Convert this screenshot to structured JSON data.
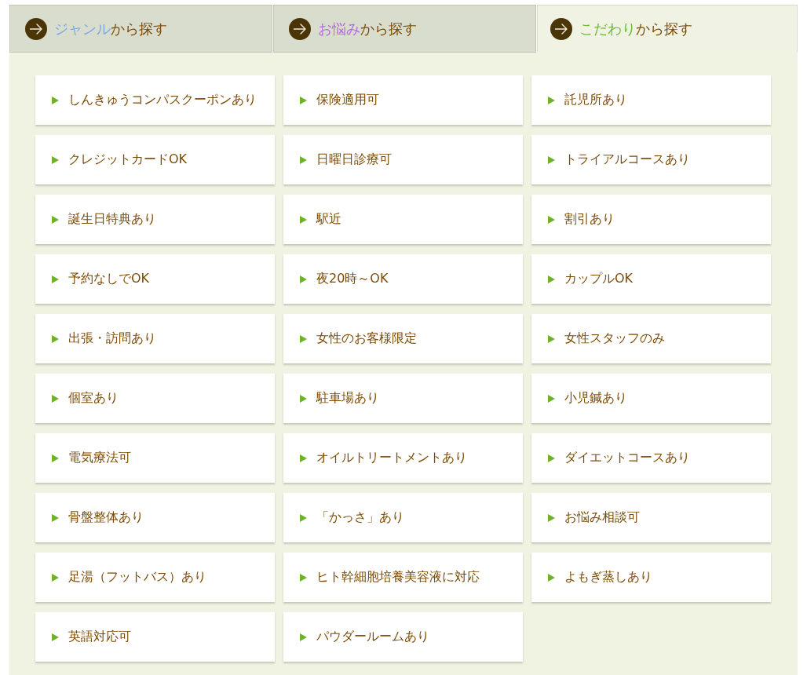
{
  "tabs": [
    {
      "accent": "ジャンル",
      "label": "から探す",
      "color": "#7ba7e3",
      "selected": false
    },
    {
      "accent": "お悩み",
      "label": "から探す",
      "color": "#b46ad6",
      "selected": false
    },
    {
      "accent": "こだわり",
      "label": "から探す",
      "color": "#6cba32",
      "selected": true
    }
  ],
  "items": [
    "しんきゅうコンパスクーポンあり",
    "保険適用可",
    "託児所あり",
    "クレジットカードOK",
    "日曜日診療可",
    "トライアルコースあり",
    "誕生日特典あり",
    "駅近",
    "割引あり",
    "予約なしでOK",
    "夜20時～OK",
    "カップルOK",
    "出張・訪問あり",
    "女性のお客様限定",
    "女性スタッフのみ",
    "個室あり",
    "駐車場あり",
    "小児鍼あり",
    "電気療法可",
    "オイルトリートメントあり",
    "ダイエットコースあり",
    "骨盤整体あり",
    "「かっさ」あり",
    "お悩み相談可",
    "足湯（フットバス）あり",
    "ヒト幹細胞培養美容液に対応",
    "よもぎ蒸しあり",
    "英語対応可",
    "パウダールームあり"
  ]
}
